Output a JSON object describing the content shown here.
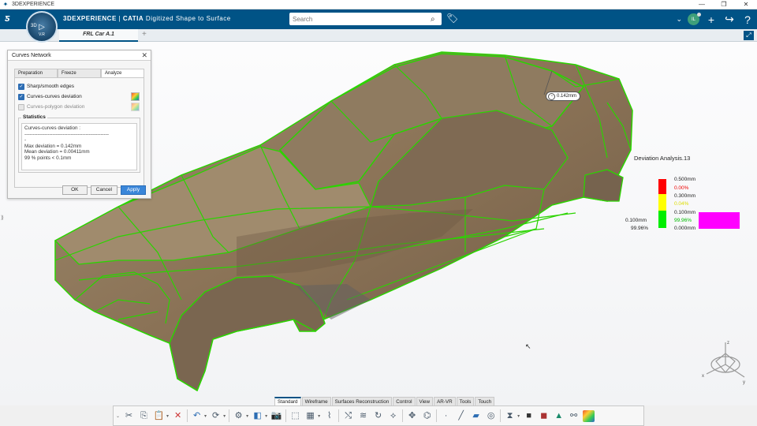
{
  "os": {
    "title": "3DEXPERIENCE",
    "controls": [
      "—",
      "❐",
      "✕"
    ]
  },
  "header": {
    "brand_prefix": "3DEXPERIENCE",
    "brand_sep": " | ",
    "brand_app": "CATIA",
    "brand_role": "Digitized Shape to Surface",
    "compass_3d": "3D",
    "compass_version": "V.R",
    "search_placeholder": "Search",
    "avatar_initials": "IL"
  },
  "document_tab": {
    "label": "FRL Car A.1",
    "add": "+"
  },
  "dialog": {
    "title": "Curves Network",
    "tabs": [
      "Preparation",
      "Freeze",
      "Analyze"
    ],
    "options": [
      {
        "label": "Sharp/smooth edges",
        "checked": true
      },
      {
        "label": "Curves-curves deviation",
        "checked": true
      },
      {
        "label": "Curves-polygon deviation",
        "checked": false
      }
    ],
    "statistics_label": "Statistics",
    "statistics_text": "Curves-curves deviation :\n---------------------------------------------------\n-\nMax deviation = 0.142mm\nMean deviation = 0.00411mm\n99 % points < 0.1mm",
    "buttons": {
      "ok": "OK",
      "cancel": "Cancel",
      "apply": "Apply"
    }
  },
  "annotation": {
    "value": "0.142mm"
  },
  "deviation": {
    "title": "Deviation Analysis.13",
    "values": [
      "0.500mm",
      "0.00%",
      "0.300mm",
      "0.04%",
      "0.100mm",
      "99.96%",
      "0.000mm"
    ],
    "selected_threshold": "0.100mm",
    "selected_percent": "99.96%",
    "colors": {
      "red": "#ff0000",
      "yellow": "#ffff00",
      "green": "#00ee00",
      "highlight": "#ff00ff"
    }
  },
  "section_tabs": [
    "Standard",
    "Wireframe",
    "Surfaces Reconstruction",
    "Control",
    "View",
    "AR-VR",
    "Tools",
    "Touch"
  ],
  "toolbar_icons": [
    "cut-icon",
    "copy-icon",
    "paste-icon",
    "undo-icon",
    "update-icon",
    "settings-icon",
    "box-icon",
    "capture-icon",
    "select-icon",
    "grid-icon",
    "curve-icon",
    "sketch-icon",
    "surface-icon",
    "network-icon",
    "net-edit-icon",
    "point-icon",
    "line-icon",
    "plane-icon",
    "circle-icon",
    "mirror-icon",
    "solid-icon",
    "solid2-icon",
    "mesh-icon",
    "connect-icon",
    "deviation-icon"
  ]
}
